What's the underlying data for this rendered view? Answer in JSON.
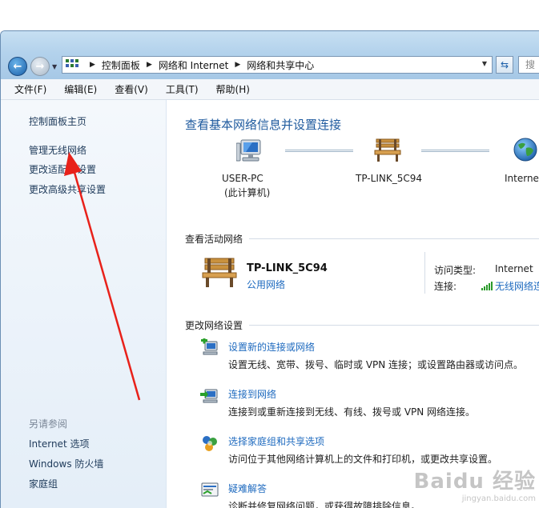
{
  "address_bar": {
    "crumbs": [
      "控制面板",
      "网络和 Internet",
      "网络和共享中心"
    ],
    "search_placeholder": "搜"
  },
  "menu": [
    "文件(F)",
    "编辑(E)",
    "查看(V)",
    "工具(T)",
    "帮助(H)"
  ],
  "sidebar": {
    "home": "控制面板主页",
    "links": [
      "管理无线网络",
      "更改适配器设置",
      "更改高级共享设置"
    ],
    "see_also_heading": "另请参阅",
    "see_also": [
      "Internet 选项",
      "Windows 防火墙",
      "家庭组"
    ]
  },
  "main": {
    "title": "查看基本网络信息并设置连接",
    "map": {
      "computer": "USER-PC",
      "computer_sub": "(此计算机)",
      "router": "TP-LINK_5C94",
      "internet": "Internet"
    },
    "active_heading": "查看活动网络",
    "network": {
      "name": "TP-LINK_5C94",
      "type": "公用网络",
      "access_label": "访问类型:",
      "access_value": "Internet",
      "connection_label": "连接:",
      "connection_value": "无线网络连"
    },
    "change_heading": "更改网络设置",
    "tasks": [
      {
        "icon": "new-connection-icon",
        "link": "设置新的连接或网络",
        "desc": "设置无线、宽带、拨号、临时或 VPN 连接；或设置路由器或访问点。"
      },
      {
        "icon": "connect-network-icon",
        "link": "连接到网络",
        "desc": "连接到或重新连接到无线、有线、拨号或 VPN 网络连接。"
      },
      {
        "icon": "homegroup-icon",
        "link": "选择家庭组和共享选项",
        "desc": "访问位于其他网络计算机上的文件和打印机，或更改共享设置。"
      },
      {
        "icon": "troubleshoot-icon",
        "link": "疑难解答",
        "desc": "诊断并修复网络问题，或获得故障排除信息。"
      }
    ]
  },
  "watermark": {
    "big": "Baidu 经验",
    "small": "jingyan.baidu.com"
  },
  "colors": {
    "link": "#1e6abf",
    "title": "#1e5a9e",
    "annotation_arrow": "#e8211a"
  }
}
